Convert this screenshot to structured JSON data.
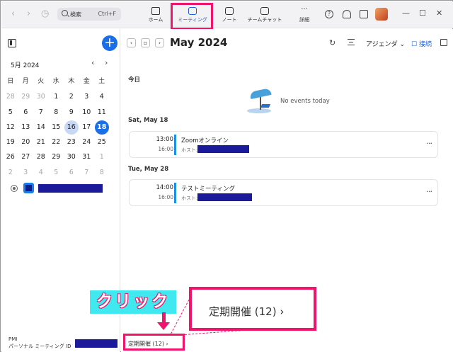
{
  "topbar": {
    "search_placeholder": "検索",
    "search_shortcut": "Ctrl+F",
    "tabs": [
      {
        "label": "ホーム"
      },
      {
        "label": "ミーティング"
      },
      {
        "label": "ノート"
      },
      {
        "label": "チームチャット"
      },
      {
        "label": "詳細"
      }
    ]
  },
  "sidebar": {
    "month_label": "5月 2024",
    "weekdays": [
      "日",
      "月",
      "火",
      "水",
      "木",
      "金",
      "土"
    ],
    "weeks": [
      [
        "28",
        "29",
        "30",
        "1",
        "2",
        "3",
        "4"
      ],
      [
        "5",
        "6",
        "7",
        "8",
        "9",
        "10",
        "11"
      ],
      [
        "12",
        "13",
        "14",
        "15",
        "16",
        "17",
        "18"
      ],
      [
        "19",
        "20",
        "21",
        "22",
        "23",
        "24",
        "25"
      ],
      [
        "26",
        "27",
        "28",
        "29",
        "30",
        "31",
        "1"
      ],
      [
        "2",
        "3",
        "4",
        "5",
        "6",
        "7",
        "8"
      ]
    ],
    "pmi_label": "PMI",
    "pmi_sub": "パーソナル ミーティング ID"
  },
  "main": {
    "month_title": "May 2024",
    "view_label": "アジェンダ",
    "connect_label": "接続",
    "today_label": "今日",
    "no_events": "No events today",
    "groups": [
      {
        "date": "Sat, May 18",
        "event": {
          "start": "13:00",
          "end": "16:00",
          "title": "Zoomオンライン",
          "host_label": "ホスト:"
        }
      },
      {
        "date": "Tue, May 28",
        "event": {
          "start": "14:00",
          "end": "16:00",
          "title": "テストミーティング",
          "host_label": "ホスト:"
        }
      }
    ],
    "recurring_link": "定期開催 (12)"
  },
  "annotation": {
    "click_label": "クリック",
    "zoom_text": "定期開催 (12)"
  },
  "colors": {
    "accent": "#1a6fe8",
    "highlight": "#f0146c",
    "label_bg": "#40e8f0"
  }
}
